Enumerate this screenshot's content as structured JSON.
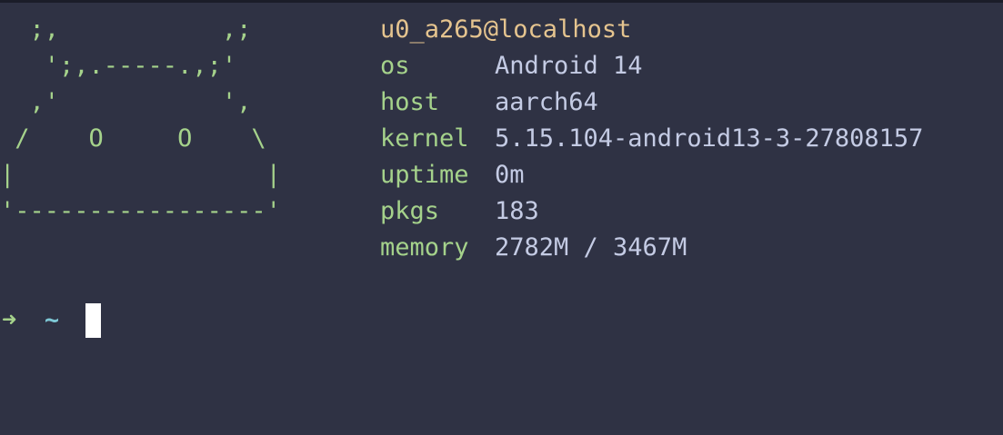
{
  "colors": {
    "background": "#2f3244",
    "logo": "#a5d28b",
    "user_host": "#e5c48f",
    "key": "#a5d28b",
    "value": "#c4cbe4",
    "cwd": "#7ec8d6",
    "cursor": "#ffffff"
  },
  "logo": {
    "art": "  ;,           ,;\n   ';,.-----.,;'\n  ,'           ',\n /    O     O    \\\n|                 |\n'-----------------'"
  },
  "fetch": {
    "user_host": "u0_a265@localhost",
    "rows": [
      {
        "key": "os",
        "value": "Android 14"
      },
      {
        "key": "host",
        "value": "aarch64"
      },
      {
        "key": "kernel",
        "value": "5.15.104-android13-3-27808157"
      },
      {
        "key": "uptime",
        "value": "0m"
      },
      {
        "key": "pkgs",
        "value": "183"
      },
      {
        "key": "memory",
        "value": "2782M / 3467M"
      }
    ]
  },
  "prompt": {
    "arrow": "➜",
    "cwd": "~",
    "input": ""
  }
}
